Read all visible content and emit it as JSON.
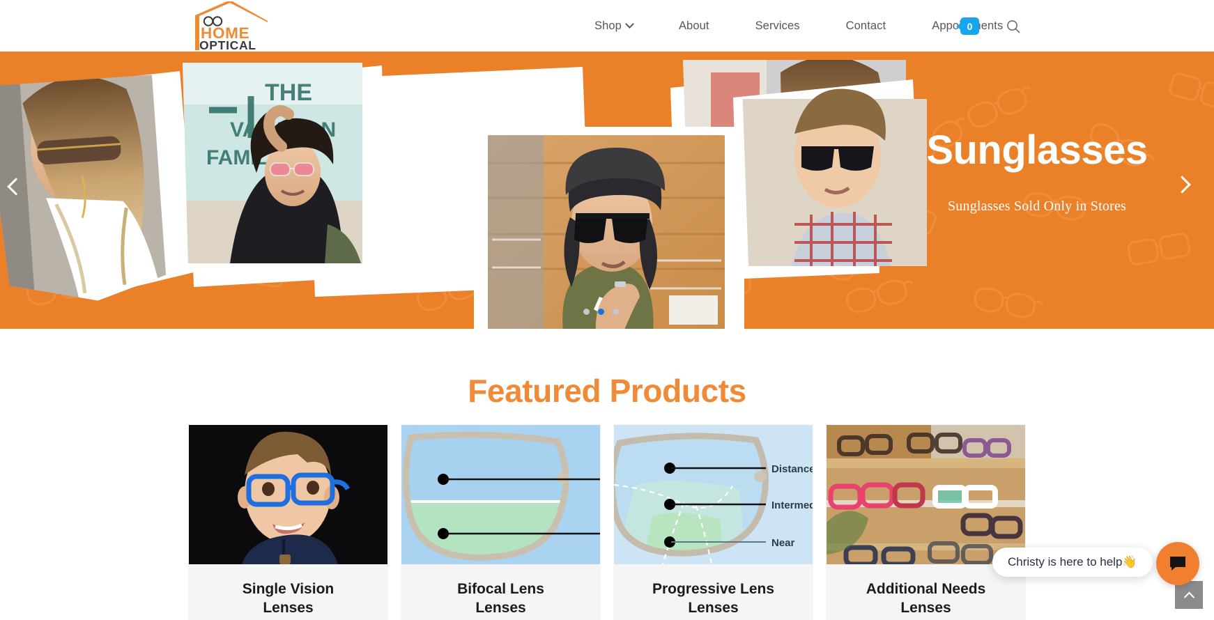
{
  "brand": {
    "name_top": "HOME",
    "name_bottom": "OPTICAL",
    "logo_icon": "house-glasses-logo",
    "orange": "#EA8129",
    "dark": "#3A3A3A"
  },
  "header": {
    "nav": [
      {
        "label": "Shop",
        "has_dropdown": true,
        "icon": "chevron-down-icon"
      },
      {
        "label": "About",
        "has_dropdown": false
      },
      {
        "label": "Services",
        "has_dropdown": false
      },
      {
        "label": "Contact",
        "has_dropdown": false
      },
      {
        "label": "Appointments",
        "has_dropdown": false
      }
    ],
    "cart": {
      "count": "0",
      "badge_color": "#16A6EE",
      "icon": "cart-badge"
    },
    "search": {
      "icon": "search-icon",
      "label": "Search"
    }
  },
  "hero": {
    "title": "Sunglasses",
    "subtitle": "Sunglasses Sold Only in Stores",
    "background_color": "#EA8129",
    "prev_icon": "chevron-left-icon",
    "next_icon": "chevron-right-icon",
    "slides": [
      {
        "index": 1,
        "active": false
      },
      {
        "index": 2,
        "active": true
      },
      {
        "index": 3,
        "active": false
      }
    ],
    "photos": [
      "woman-white-blouse-sunglasses",
      "man-pink-tinted-glasses-mural",
      "woman-oversize-shield-sunglasses",
      "man-beanie-black-sunglasses",
      "boy-plaid-shirt-sunglasses"
    ]
  },
  "featured": {
    "heading": "Featured Products",
    "heading_color": "#F08A36",
    "products": [
      {
        "title_line1": "Single Vision",
        "title_line2": "Lenses",
        "image": "boy-blue-eyeglasses-photo"
      },
      {
        "title_line1": "Bifocal Lens",
        "title_line2": "Lenses",
        "image": "bifocal-lens-diagram"
      },
      {
        "title_line1": "Progressive Lens",
        "title_line2": "Lenses",
        "image": "progressive-lens-diagram",
        "diagram_labels": [
          "Distance",
          "Intermediate",
          "Near"
        ]
      },
      {
        "title_line1": "Additional Needs",
        "title_line2": "Lenses",
        "image": "eyewear-display-shelf-photo"
      }
    ]
  },
  "chat": {
    "greeting": "Christy is here to help👋",
    "button_icon": "chat-bubble-icon",
    "button_color": "#F08030"
  },
  "scroll_top": {
    "icon": "chevron-up-icon",
    "label": "Back to top"
  }
}
